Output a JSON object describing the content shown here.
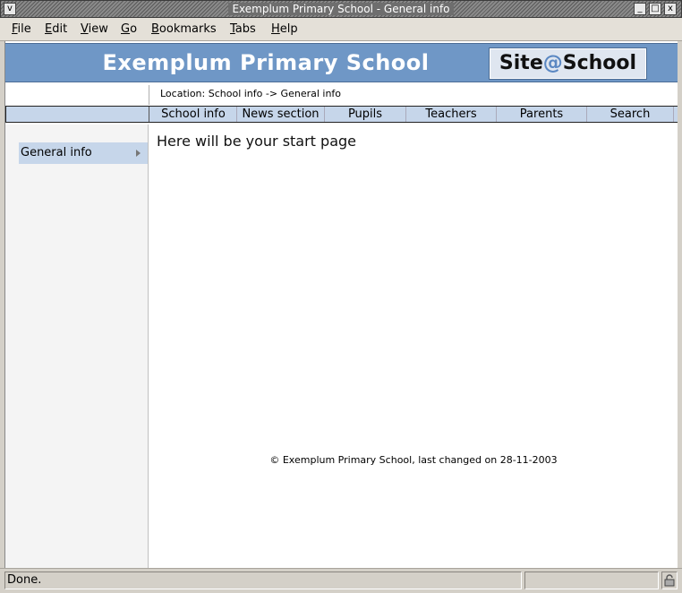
{
  "window": {
    "title": "Exemplum Primary School - General info",
    "menu_btn": "v",
    "min_btn": "_",
    "max_btn": "□",
    "close_btn": "x"
  },
  "menubar": {
    "items": [
      {
        "u": "F",
        "rest": "ile"
      },
      {
        "u": "E",
        "rest": "dit"
      },
      {
        "u": "V",
        "rest": "iew"
      },
      {
        "u": "G",
        "rest": "o"
      },
      {
        "u": "B",
        "rest": "ookmarks"
      },
      {
        "u": "T",
        "rest": "abs"
      },
      {
        "u": "H",
        "rest": "elp"
      }
    ]
  },
  "page": {
    "banner": {
      "school_name": "Exemplum Primary School",
      "logo_prefix": "Site",
      "logo_at": "@",
      "logo_suffix": "School"
    },
    "location": "Location: School info -> General info",
    "nav": [
      "School info",
      "News section",
      "Pupils",
      "Teachers",
      "Parents",
      "Search"
    ],
    "sidebar": {
      "items": [
        {
          "label": "General info"
        }
      ]
    },
    "main_text": "Here will be your start page",
    "footer": "© Exemplum Primary School, last changed on 28-11-2003"
  },
  "statusbar": {
    "text": "Done."
  },
  "icons": {
    "sidebar_arrow": "triangle-right-icon",
    "security": "lock-icon"
  }
}
